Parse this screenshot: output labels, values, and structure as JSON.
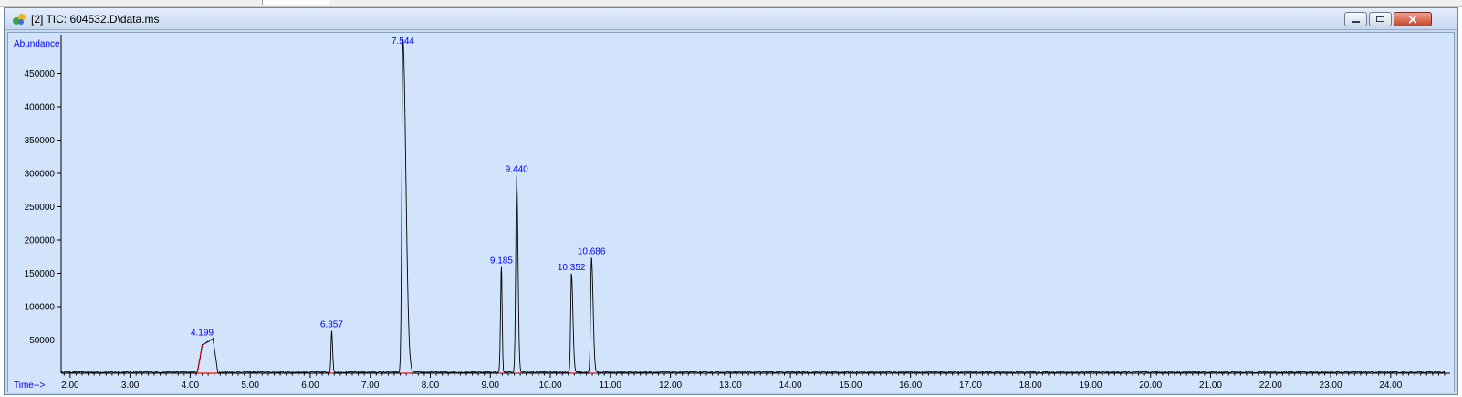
{
  "window": {
    "title": "[2] TIC: 604532.D\\data.ms",
    "icon": "chromatogram-app-icon",
    "controls": [
      "minimize-icon",
      "maximize-icon",
      "close-icon"
    ]
  },
  "colors": {
    "plot_background": "#d2e4fc",
    "trace": "#000000",
    "label_text": "#0000ff",
    "baseline_marker": "#ff0000"
  },
  "chart_data": {
    "type": "line",
    "ylabel": "Abundance",
    "xlabel": "Time-->",
    "xlim": [
      1.85,
      24.9
    ],
    "ylim": [
      0,
      500000
    ],
    "x_ticks": [
      2,
      3,
      4,
      5,
      6,
      7,
      8,
      9,
      10,
      11,
      12,
      13,
      14,
      15,
      16,
      17,
      18,
      19,
      20,
      21,
      22,
      23,
      24
    ],
    "x_tick_labels": [
      "2.00",
      "3.00",
      "4.00",
      "5.00",
      "6.00",
      "7.00",
      "8.00",
      "9.00",
      "10.00",
      "11.00",
      "12.00",
      "13.00",
      "14.00",
      "15.00",
      "16.00",
      "17.00",
      "18.00",
      "19.00",
      "20.00",
      "21.00",
      "22.00",
      "23.00",
      "24.00"
    ],
    "y_ticks": [
      50000,
      100000,
      150000,
      200000,
      250000,
      300000,
      350000,
      400000,
      450000
    ],
    "y_tick_labels": [
      "50000",
      "100000",
      "150000",
      "200000",
      "250000",
      "300000",
      "350000",
      "400000",
      "450000"
    ],
    "grid": false,
    "baseline": 1500,
    "peaks": [
      {
        "label": "4.199",
        "rt": 4.199,
        "start": 4.12,
        "end": 4.46,
        "height": 50000,
        "shape": "broad"
      },
      {
        "label": "6.357",
        "rt": 6.357,
        "start": 6.33,
        "end": 6.4,
        "height": 62000
      },
      {
        "label": "7.544",
        "rt": 7.544,
        "start": 7.5,
        "end": 7.68,
        "height": 500000
      },
      {
        "label": "9.185",
        "rt": 9.185,
        "start": 9.15,
        "end": 9.22,
        "height": 158000
      },
      {
        "label": "9.440",
        "rt": 9.44,
        "start": 9.4,
        "end": 9.5,
        "height": 295000
      },
      {
        "label": "10.352",
        "rt": 10.352,
        "start": 10.32,
        "end": 10.42,
        "height": 148000
      },
      {
        "label": "10.686",
        "rt": 10.686,
        "start": 10.65,
        "end": 10.76,
        "height": 172000
      }
    ]
  }
}
